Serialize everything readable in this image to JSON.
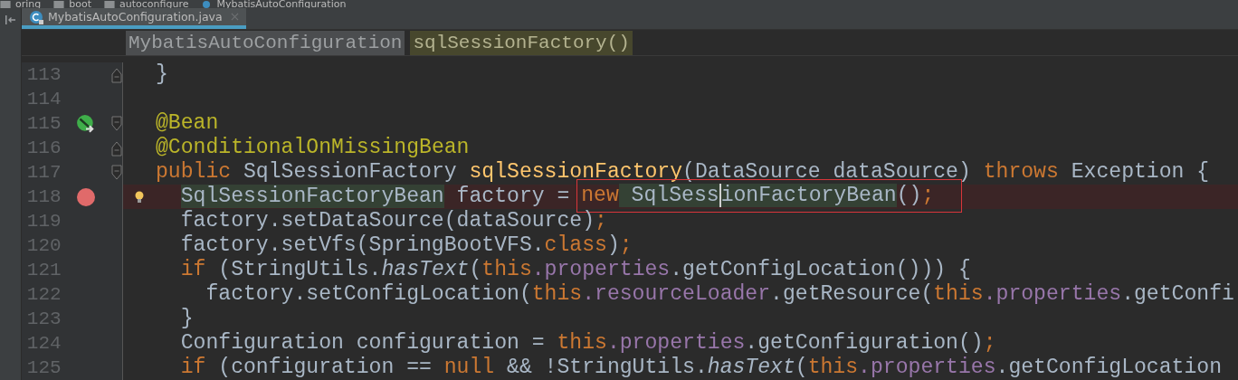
{
  "breadcrumbs": [
    {
      "label": "oring",
      "kind": "folder"
    },
    {
      "label": "boot",
      "kind": "folder"
    },
    {
      "label": "autoconfigure",
      "kind": "folder"
    },
    {
      "label": "MybatisAutoConfiguration",
      "kind": "class"
    }
  ],
  "tabs": [
    {
      "label": "MybatisAutoConfiguration.java",
      "selected": true
    }
  ],
  "header": [
    {
      "label": "MybatisAutoConfiguration",
      "kind": "class"
    },
    {
      "label": "sqlSessionFactory()",
      "kind": "method"
    }
  ],
  "lines": [
    {
      "number": "113",
      "fold_end": true,
      "tokens": [
        {
          "t": "}",
          "kind": "plain"
        }
      ]
    },
    {
      "number": "114"
    },
    {
      "number": "115",
      "fold_start": true,
      "bean_marker": true,
      "tokens": [
        {
          "t": "@Bean",
          "kind": "ann"
        }
      ]
    },
    {
      "number": "116",
      "fold_end": true,
      "tokens": [
        {
          "t": "@ConditionalOnMissingBean",
          "kind": "ann"
        }
      ]
    },
    {
      "number": "117",
      "fold_start": true,
      "tokens": [
        {
          "t": "public",
          "kind": "kw"
        },
        {
          "t": " SqlSessionFactory ",
          "kind": "plain"
        },
        {
          "t": "sqlSessionFactory",
          "kind": "fn"
        },
        {
          "t": "(DataSource dataSource) ",
          "kind": "plain"
        },
        {
          "t": "throws",
          "kind": "kw"
        },
        {
          "t": " Exception {",
          "kind": "plain"
        }
      ],
      "children": [
        {
          "number": "118",
          "breakpoint": true,
          "bulb": true,
          "tokens": [
            {
              "t": "SqlSessionFactoryBean",
              "kind": "hl"
            },
            {
              "t": " factory = ",
              "kind": "plain"
            }
          ],
          "boxed": [
            {
              "t": "new",
              "kind": "kw"
            },
            {
              "t": " SqlSess",
              "kind": "hl"
            },
            {
              "t": "ionFactoryBean",
              "kind": "hl",
              "caret": true
            },
            {
              "t": "()",
              "kind": "plain"
            },
            {
              "t": ";",
              "kind": "kw"
            }
          ]
        },
        {
          "number": "119",
          "tokens": [
            {
              "t": "factory.setDataSource(dataSource)",
              "kind": "plain"
            },
            {
              "t": ";",
              "kind": "kw"
            }
          ]
        },
        {
          "number": "120",
          "tokens": [
            {
              "t": "factory.setVfs(SpringBootVFS.",
              "kind": "plain"
            },
            {
              "t": "class",
              "kind": "kw"
            },
            {
              "t": ")",
              "kind": "plain"
            },
            {
              "t": ";",
              "kind": "kw"
            }
          ]
        },
        {
          "number": "121",
          "tokens": [
            {
              "t": "if",
              "kind": "kw"
            },
            {
              "t": " (StringUtils.",
              "kind": "plain"
            },
            {
              "t": "hasText",
              "kind": "static"
            },
            {
              "t": "(",
              "kind": "plain"
            },
            {
              "t": "this",
              "kind": "kw"
            },
            {
              "t": ".properties",
              "kind": "field"
            },
            {
              "t": ".getConfigLocation())) {",
              "kind": "plain"
            }
          ],
          "children": [
            {
              "number": "122",
              "tokens": [
                {
                  "t": "factory.setConfigLocation(",
                  "kind": "plain"
                },
                {
                  "t": "this",
                  "kind": "kw"
                },
                {
                  "t": ".resourceLoader",
                  "kind": "field"
                },
                {
                  "t": ".getResource(",
                  "kind": "plain"
                },
                {
                  "t": "this",
                  "kind": "kw"
                },
                {
                  "t": ".properties",
                  "kind": "field"
                },
                {
                  "t": ".getConfi",
                  "kind": "plain"
                }
              ]
            }
          ]
        },
        {
          "number": "123",
          "tokens": [
            {
              "t": "}",
              "kind": "plain"
            }
          ]
        },
        {
          "number": "124",
          "tokens": [
            {
              "t": "Configuration configuration = ",
              "kind": "plain"
            },
            {
              "t": "this",
              "kind": "kw"
            },
            {
              "t": ".properties",
              "kind": "field"
            },
            {
              "t": ".getConfiguration()",
              "kind": "plain"
            },
            {
              "t": ";",
              "kind": "kw"
            }
          ]
        },
        {
          "number": "125",
          "tokens": [
            {
              "t": "if",
              "kind": "kw"
            },
            {
              "t": " (configuration == ",
              "kind": "plain"
            },
            {
              "t": "null",
              "kind": "kw"
            },
            {
              "t": " && !StringUtils.",
              "kind": "plain"
            },
            {
              "t": "hasText",
              "kind": "static"
            },
            {
              "t": "(",
              "kind": "plain"
            },
            {
              "t": "this",
              "kind": "kw"
            },
            {
              "t": ".properties",
              "kind": "field"
            },
            {
              "t": ".getConfigLocation",
              "kind": "plain"
            }
          ]
        }
      ]
    }
  ]
}
